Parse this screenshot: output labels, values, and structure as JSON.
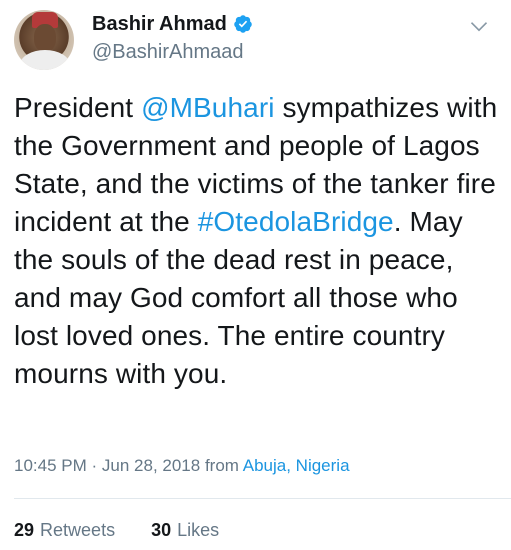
{
  "author": {
    "display_name": "Bashir Ahmad",
    "handle": "@BashirAhmaad",
    "verified": true,
    "avatar_icon": "profile-photo"
  },
  "tweet": {
    "text_before_mention": "President ",
    "mention": "@MBuhari",
    "text_middle": " sympathizes with the Government and people of Lagos State, and the victims of the tanker fire incident at the ",
    "hashtag": "#OtedolaBridge",
    "text_after_hashtag": ". May the souls of the dead rest in peace, and may God comfort all those who lost loved ones. The entire country mourns with you."
  },
  "meta": {
    "time": "10:45 PM",
    "separator": "·",
    "date": "Jun 28, 2018",
    "from_label": "from",
    "location": "Abuja, Nigeria"
  },
  "stats": {
    "retweets_count": "29",
    "retweets_label": "Retweets",
    "likes_count": "30",
    "likes_label": "Likes"
  },
  "colors": {
    "link": "#1b95e0",
    "secondary_text": "#657786",
    "primary_text": "#14171a",
    "verified_badge": "#1da1f2"
  }
}
